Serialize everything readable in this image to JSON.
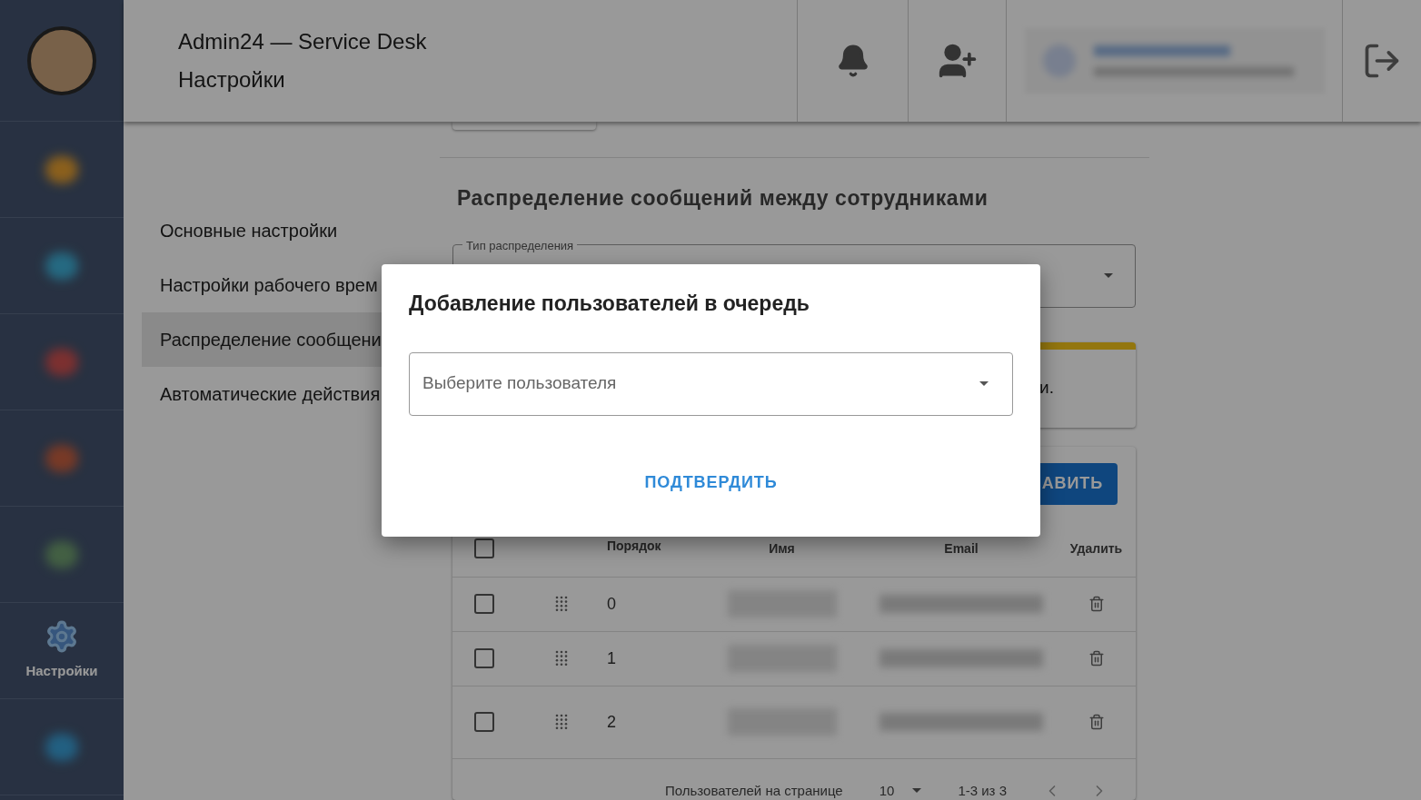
{
  "sidebar": {
    "items": [
      {
        "kind": "blurred"
      },
      {
        "kind": "blurred"
      },
      {
        "kind": "blurred"
      },
      {
        "kind": "blurred"
      },
      {
        "kind": "blurred"
      },
      {
        "kind": "settings",
        "label": "Настройки"
      },
      {
        "kind": "blurred"
      }
    ]
  },
  "header": {
    "title": "Admin24 — Service Desk",
    "subtitle": "Настройки"
  },
  "settings_nav": [
    {
      "label": "Основные настройки",
      "selected": false
    },
    {
      "label": "Настройки рабочего врем",
      "selected": false
    },
    {
      "label": "Распределение сообщени",
      "selected": true
    },
    {
      "label": "Автоматические действия",
      "selected": false
    }
  ],
  "section": {
    "title": "Распределение сообщений между сотрудниками",
    "select_label": "Тип распределения",
    "info_text": "и.",
    "add_button": "АВИТЬ"
  },
  "table": {
    "columns": [
      "Порядок",
      "Имя",
      "Email",
      "Удалить"
    ],
    "rows": [
      {
        "order": "0",
        "checked": false
      },
      {
        "order": "1",
        "checked": false
      },
      {
        "order": "2",
        "checked": false
      }
    ],
    "all_checked": false,
    "pagination": {
      "label": "Пользователей на странице",
      "per_page": "10",
      "range": "1-3 из 3"
    }
  },
  "dialog": {
    "title": "Добавление пользователей в очередь",
    "placeholder": "Выберите пользователя",
    "confirm": "ПОДТВЕРДИТЬ"
  }
}
